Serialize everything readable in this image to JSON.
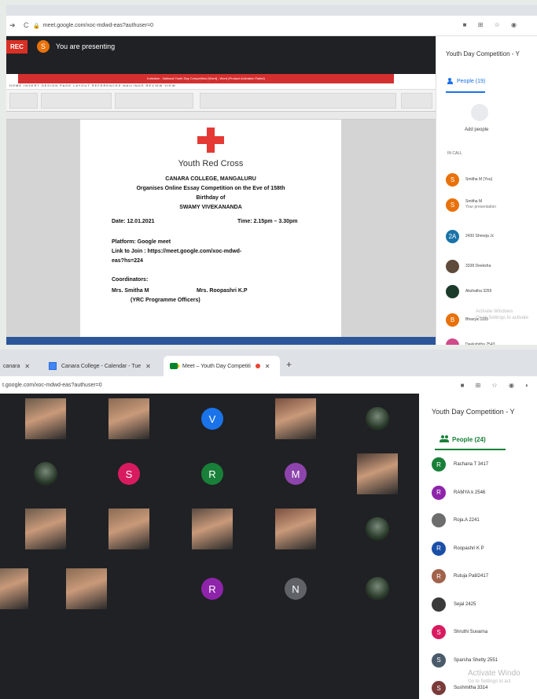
{
  "top": {
    "url": "meet.google.com/xoc-mdwd-eas?authuser=0",
    "rec_label": "REC",
    "presenter_avatar": "S",
    "presenting_text": "You are presenting",
    "word_title": "Invitation - National Youth Day Competition [Word] - Word (Product Activation Failed)",
    "menu": "HOME   INSERT   DESIGN   PAGE LAYOUT   REFERENCES   MAILINGS   REVIEW   VIEW",
    "doc": {
      "org": "Youth Red Cross",
      "college": "CANARA COLLEGE, MANGALURU",
      "line1": "Organises Online Essay Competition on the Eve of 158th",
      "line2": "Birthday of",
      "line3": "SWAMY VIVEKANANDA",
      "date": "Date: 12.01.2021",
      "time": "Time: 2.15pm – 3.30pm",
      "platform": "Platform: Google meet",
      "link1": "Link to Join : https://meet.google.com/xoc-mdwd-",
      "link2": "eas?hs=224",
      "coord": "Coordinators:",
      "c1": "Mrs. Smitha M",
      "c2": "Mrs. Roopashri K.P",
      "c3": "(YRC Programme Officers)"
    },
    "panel": {
      "title": "Youth Day Competition - Y",
      "people_tab": "People (19)",
      "add_people": "Add people",
      "in_call": "IN CALL",
      "participants": [
        {
          "initial": "S",
          "name": "Smitha M (You)",
          "sub": "",
          "color": "#e8710a"
        },
        {
          "initial": "S",
          "name": "Smitha M",
          "sub": "Your presentation",
          "color": "#e8710a"
        },
        {
          "initial": "2A",
          "name": "2430 Shreeja Jc",
          "sub": "",
          "color": "#1a73a8"
        },
        {
          "initial": "",
          "name": "3338 Deeksha",
          "sub": "",
          "color": "#5f4b3b"
        },
        {
          "initial": "",
          "name": "Akshatha 3255",
          "sub": "",
          "color": "#1b3a2a"
        },
        {
          "initial": "B",
          "name": "Bhavya 3335",
          "sub": "",
          "color": "#e8710a"
        },
        {
          "initial": "",
          "name": "Deekshitha 2543",
          "sub": "",
          "color": "#d04a8a"
        }
      ],
      "watermark1": "Activate Windows",
      "watermark2": "Go to Settings to activate"
    }
  },
  "bottom": {
    "tab1": "canara",
    "tab2": "Canara College - Calendar - Tue",
    "tab3": "Meet – Youth Day Competiti",
    "close": "✕",
    "newtab": "+",
    "url": "t.google.com/xoc-mdwd-eas?authuser=0",
    "tiles": [
      {
        "kind": "photo"
      },
      {
        "kind": "photo"
      },
      {
        "kind": "letter",
        "letter": "V",
        "color": "#1a73e8"
      },
      {
        "kind": "photo"
      },
      {
        "kind": "img"
      },
      {
        "kind": "img"
      },
      {
        "kind": "letter",
        "letter": "S",
        "color": "#d81b60"
      },
      {
        "kind": "letter",
        "letter": "R",
        "color": "#188038"
      },
      {
        "kind": "letter",
        "letter": "M",
        "color": "#8e44ad"
      },
      {
        "kind": "photo"
      },
      {
        "kind": "photo"
      },
      {
        "kind": "photo"
      },
      {
        "kind": "photo"
      },
      {
        "kind": "photo"
      },
      {
        "kind": "img"
      },
      {
        "kind": "photo"
      },
      {
        "kind": "photo"
      },
      {
        "kind": "letter",
        "letter": "R",
        "color": "#8e24aa"
      },
      {
        "kind": "letter",
        "letter": "N",
        "color": "#5f6368"
      },
      {
        "kind": "img"
      }
    ],
    "panel": {
      "title": "Youth Day Competition - Y",
      "people_tab": "People (24)",
      "participants": [
        {
          "initial": "R",
          "name": "Rachana T 3417",
          "color": "#188038"
        },
        {
          "initial": "R",
          "name": "RAMYA k 2546",
          "color": "#8e24aa"
        },
        {
          "initial": "",
          "name": "Roja.A 2241",
          "color": "#6d6d6d"
        },
        {
          "initial": "R",
          "name": "Roopashri K P",
          "color": "#1a4fa8"
        },
        {
          "initial": "R",
          "name": "Rutuja Patil2417",
          "color": "#a0624a"
        },
        {
          "initial": "",
          "name": "Sejal 2425",
          "color": "#3a3a3a"
        },
        {
          "initial": "S",
          "name": "Shruthi Suvarna",
          "color": "#d81b60"
        },
        {
          "initial": "S",
          "name": "Sparsha Shetty 2551",
          "color": "#4a5a6a"
        },
        {
          "initial": "S",
          "name": "Sushmitha 3314",
          "color": "#7a3a3a"
        }
      ],
      "watermark1": "Activate Windo",
      "watermark2": "Go to Settings to act"
    }
  }
}
